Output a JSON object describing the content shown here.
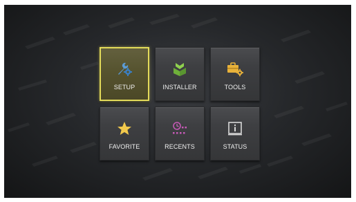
{
  "menu": {
    "tiles": [
      {
        "label": "SETUP",
        "icon": "wrench-gear-icon",
        "selected": true
      },
      {
        "label": "INSTALLER",
        "icon": "installer-icon",
        "selected": false
      },
      {
        "label": "TOOLS",
        "icon": "toolbox-gear-icon",
        "selected": false
      },
      {
        "label": "FAVORITE",
        "icon": "star-icon",
        "selected": false
      },
      {
        "label": "RECENTS",
        "icon": "clock-dots-icon",
        "selected": false
      },
      {
        "label": "STATUS",
        "icon": "info-box-icon",
        "selected": false
      }
    ]
  },
  "colors": {
    "selection_border": "#e3db5a",
    "setup_icon": "#5b9bd5",
    "installer_icon": "#7fbf3f",
    "tools_icon": "#e8b23a",
    "favorite_icon": "#f2c94c",
    "recents_icon": "#c85ab8",
    "status_icon": "#d9d9d9"
  }
}
